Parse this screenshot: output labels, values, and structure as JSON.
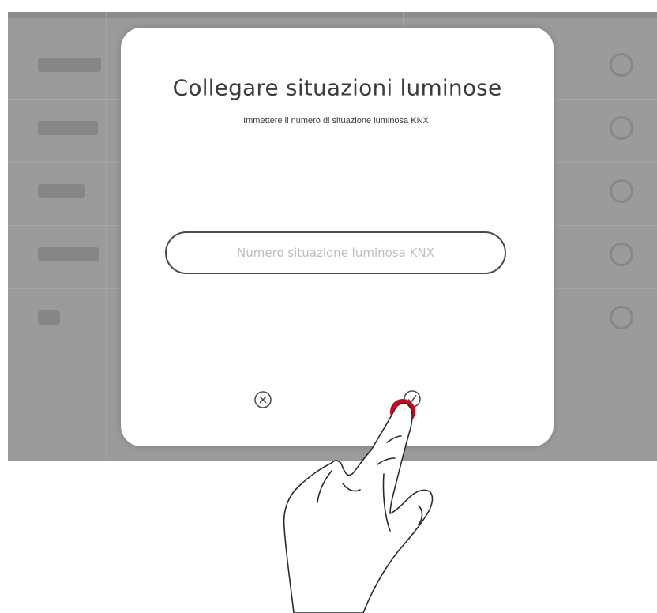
{
  "dialog": {
    "title": "Collegare situazioni luminose",
    "instruction": "Immettere il numero di situazione luminosa KNX.",
    "input": {
      "placeholder": "Numero situazione luminosa KNX",
      "value": ""
    },
    "cancel_icon": "close-circle-icon",
    "confirm_icon": "checkmark-circle-icon"
  },
  "background": {
    "row_count": 5
  },
  "colors": {
    "touch_indicator": "#d9001b",
    "dim_overlay": "#9b9b9b",
    "dialog_background": "#ffffff"
  }
}
